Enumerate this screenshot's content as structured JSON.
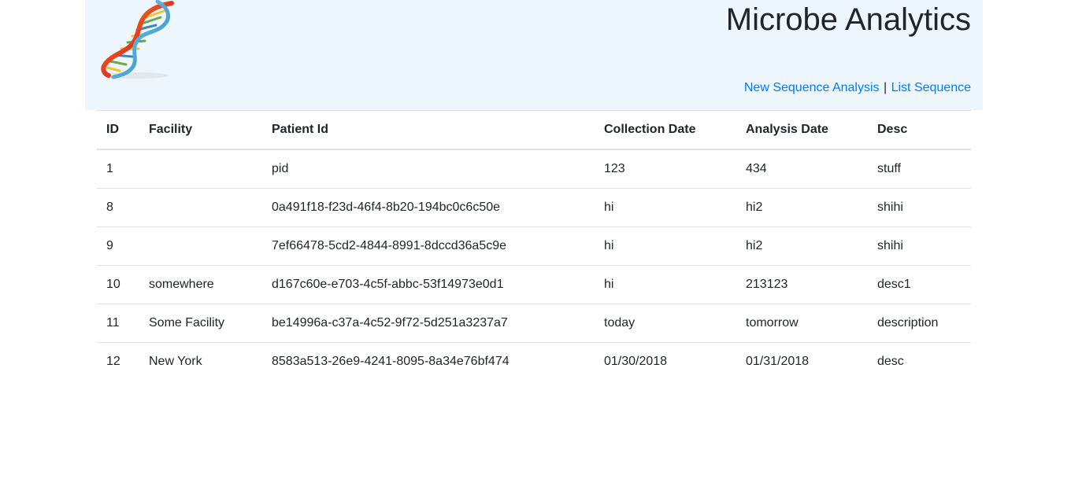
{
  "header": {
    "title": "Microbe Analytics",
    "logo_icon": "dna-helix-icon",
    "nav": {
      "new_sequence_label": "New Sequence Analysis",
      "separator": "|",
      "list_sequence_label": "List Sequence"
    }
  },
  "colors": {
    "header_bg": "#eef6fd",
    "link": "#007bff",
    "border": "#dee2e6"
  },
  "table": {
    "columns": [
      "ID",
      "Facility",
      "Patient Id",
      "Collection Date",
      "Analysis Date",
      "Desc"
    ],
    "rows": [
      [
        "1",
        "",
        "pid",
        "123",
        "434",
        "stuff"
      ],
      [
        "8",
        "",
        "0a491f18-f23d-46f4-8b20-194bc0c6c50e",
        "hi",
        "hi2",
        "shihi"
      ],
      [
        "9",
        "",
        "7ef66478-5cd2-4844-8991-8dccd36a5c9e",
        "hi",
        "hi2",
        "shihi"
      ],
      [
        "10",
        "somewhere",
        "d167c60e-e703-4c5f-abbc-53f14973e0d1",
        "hi",
        "213123",
        "desc1"
      ],
      [
        "11",
        "Some Facility",
        "be14996a-c37a-4c52-9f72-5d251a3237a7",
        "today",
        "tomorrow",
        "description"
      ],
      [
        "12",
        "New York",
        "8583a513-26e9-4241-8095-8a34e76bf474",
        "01/30/2018",
        "01/31/2018",
        "desc"
      ]
    ]
  }
}
